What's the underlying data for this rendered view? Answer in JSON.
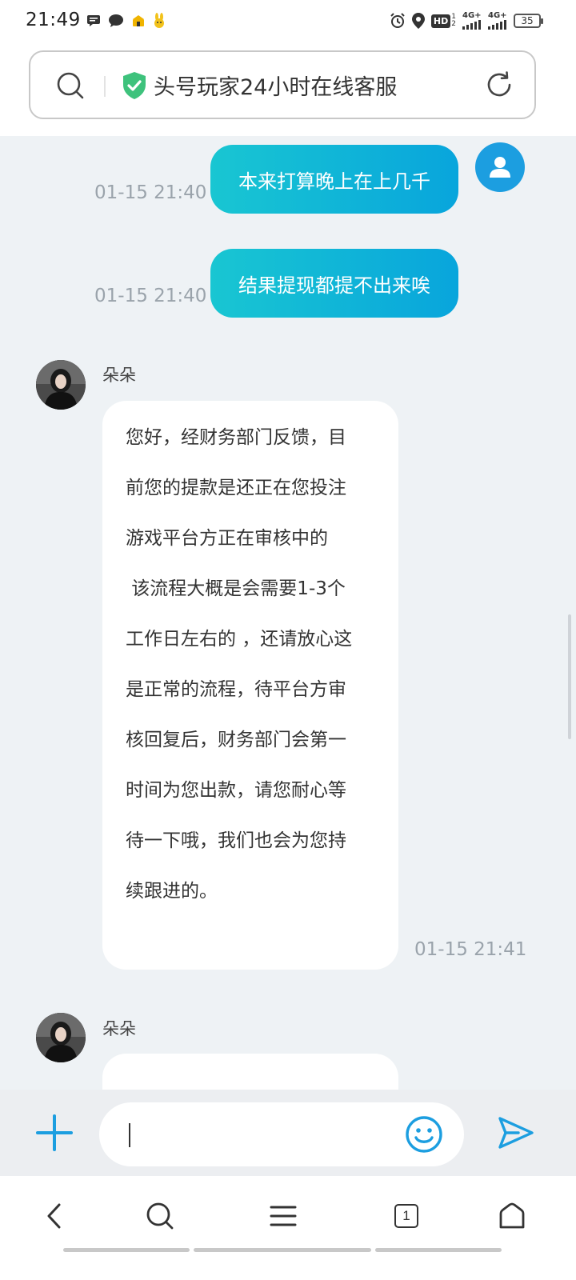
{
  "status_bar": {
    "time": "21:49",
    "left_icons": [
      "message-icon",
      "chat-bubble-icon",
      "app-icon",
      "bunny-icon"
    ],
    "right_icons": [
      "alarm-icon",
      "location-icon",
      "hd-icon",
      "signal-4g-icon",
      "signal-4g-icon-2"
    ],
    "hd_label": "HD",
    "net1_label": "4G+",
    "net2_label": "4G+",
    "battery_level": "35"
  },
  "url_bar": {
    "title": "头号玩家24小时在线客服",
    "shield_color": "#3ec27c"
  },
  "messages": [
    {
      "type": "outgoing",
      "text": "本来打算晚上在上几千",
      "time": "01-15 21:40"
    },
    {
      "type": "outgoing",
      "text": "结果提现都提不出来唉",
      "time": "01-15 21:40"
    },
    {
      "type": "incoming",
      "sender": "朵朵",
      "lines": [
        "您好，经财务部门反馈，目",
        "前您的提款是还正在您投注",
        "游戏平台方正在审核中的",
        " 该流程大概是会需要1-3个",
        "工作日左右的 ，还请放心这",
        "是正常的流程，待平台方审",
        "核回复后，财务部门会第一",
        "时间为您出款，请您耐心等",
        "待一下哦，我们也会为您持",
        "续跟进的。"
      ],
      "time": "01-15 21:41"
    },
    {
      "type": "incoming",
      "sender": "朵朵",
      "lines": [],
      "time": ""
    }
  ],
  "input": {
    "placeholder": "",
    "value": ""
  },
  "bottom_nav": {
    "tab_count": "1",
    "items": [
      "back-icon",
      "search-icon",
      "menu-icon",
      "tabs-icon",
      "home-icon"
    ]
  },
  "colors": {
    "accent": "#1c9ee0",
    "bubble_gradient_start": "#19c6d2",
    "bubble_gradient_end": "#08a5dc",
    "chat_background": "#eef2f5"
  }
}
